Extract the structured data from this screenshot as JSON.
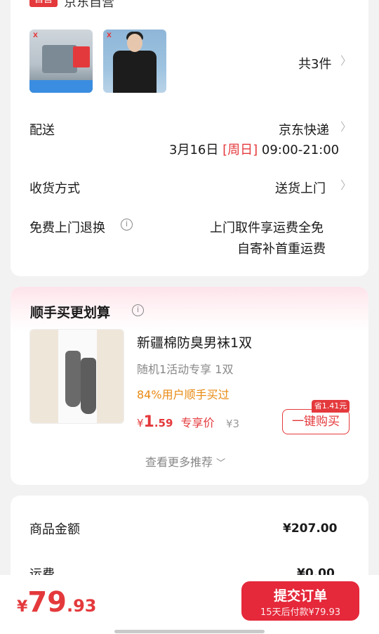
{
  "order": {
    "shop_tag": "自营",
    "shop_name": "京东自营",
    "items_count": "共3件",
    "delivery": {
      "label": "配送",
      "method": "京东快递",
      "date": "3月16日",
      "weekday": "[周日]",
      "time": "09:00-21:00"
    },
    "receive": {
      "label": "收货方式",
      "value": "送货上门"
    },
    "returns": {
      "label": "免费上门退换",
      "line1": "上门取件享运费全免",
      "line2": "自寄补首重运费"
    }
  },
  "addon": {
    "title": "顺手买更划算",
    "product": {
      "name": "新疆棉防臭男袜1双",
      "subtitle": "随机1活动专享 1双",
      "social_proof": "84%用户顺手买过",
      "currency": "¥",
      "price_int": "1",
      "price_dec": ".59",
      "price_tag": "专享价",
      "original_price": "¥3",
      "save_badge": "省1.41元",
      "buy_label": "一键购买"
    },
    "more": "查看更多推荐"
  },
  "summary": {
    "goods_label": "商品金额",
    "goods_value": "¥207.00",
    "shipping_label": "运费",
    "shipping_value": "¥0.00"
  },
  "bottom": {
    "currency": "¥",
    "total_int": "79",
    "total_dec": ".93",
    "submit_label": "提交订单",
    "submit_sub": "15天后付款¥79.93"
  },
  "colors": {
    "accent": "#e4393c",
    "orange": "#e88a12"
  }
}
